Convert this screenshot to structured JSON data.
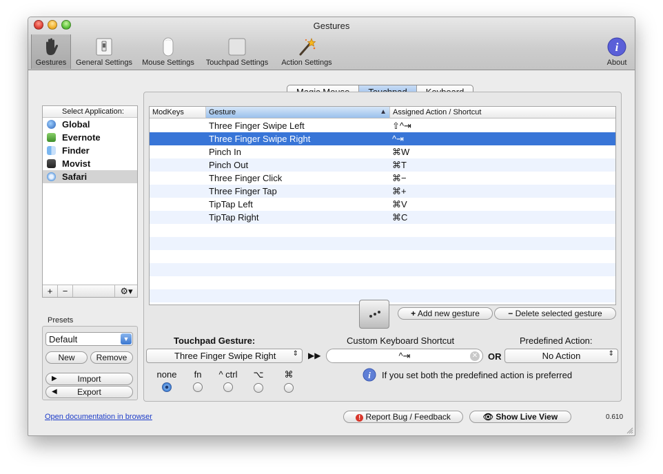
{
  "window": {
    "title": "Gestures"
  },
  "toolbar": {
    "items": [
      {
        "label": "Gestures",
        "icon": "hand-icon"
      },
      {
        "label": "General Settings",
        "icon": "switch-icon"
      },
      {
        "label": "Mouse Settings",
        "icon": "magic-mouse-icon"
      },
      {
        "label": "Touchpad Settings",
        "icon": "touchpad-icon"
      },
      {
        "label": "Action Settings",
        "icon": "magic-wand-icon"
      }
    ],
    "about_label": "About"
  },
  "device_tabs": [
    "Magic Mouse",
    "Touchpad",
    "Keyboard"
  ],
  "selected_device_tab": "Touchpad",
  "app_list": {
    "header": "Select Application:",
    "items": [
      "Global",
      "Evernote",
      "Finder",
      "Movist",
      "Safari"
    ],
    "selected": "Safari",
    "add_label": "+",
    "remove_label": "−",
    "gear_label": "⚙▾"
  },
  "presets": {
    "label": "Presets",
    "selected": "Default",
    "new_label": "New",
    "remove_label": "Remove",
    "import_label": "Import",
    "export_label": "Export"
  },
  "table": {
    "columns": [
      "ModKeys",
      "Gesture",
      "Assigned Action / Shortcut"
    ],
    "rows": [
      {
        "modkeys": "",
        "gesture": "Three Finger Swipe Left",
        "action": "⇧^⇥"
      },
      {
        "modkeys": "",
        "gesture": "Three Finger Swipe Right",
        "action": "^⇥"
      },
      {
        "modkeys": "",
        "gesture": "Pinch In",
        "action": "⌘W"
      },
      {
        "modkeys": "",
        "gesture": "Pinch Out",
        "action": "⌘T"
      },
      {
        "modkeys": "",
        "gesture": "Three Finger Click",
        "action": "⌘−"
      },
      {
        "modkeys": "",
        "gesture": "Three Finger Tap",
        "action": "⌘+"
      },
      {
        "modkeys": "",
        "gesture": "TipTap Left",
        "action": "⌘V"
      },
      {
        "modkeys": "",
        "gesture": "TipTap Right",
        "action": "⌘C"
      }
    ],
    "selected_row": 1
  },
  "actions": {
    "add_gesture": "Add new gesture",
    "delete_gesture": "Delete selected gesture"
  },
  "editor": {
    "gesture_label": "Touchpad Gesture:",
    "gesture_value": "Three Finger Swipe Right",
    "shortcut_label": "Custom Keyboard Shortcut",
    "shortcut_value": "^⇥",
    "or_label": "OR",
    "predefined_label": "Predefined Action:",
    "predefined_value": "No Action",
    "modifiers": [
      "none",
      "fn",
      "^ ctrl",
      "⌥",
      "⌘"
    ],
    "selected_modifier": "none",
    "info_text": "If you set both the predefined action is preferred",
    "arrow_label": "▶▶"
  },
  "footer": {
    "doc_link": "Open documentation in browser",
    "report_bug": "Report Bug / Feedback",
    "live_view": "Show Live View",
    "version": "0.610"
  }
}
